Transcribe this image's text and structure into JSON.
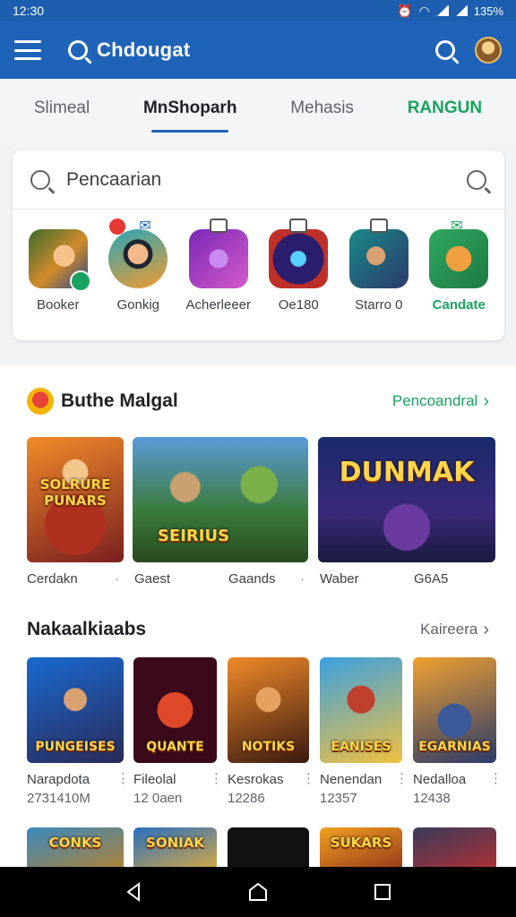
{
  "status": {
    "time": "12:30",
    "battery": "135%"
  },
  "app_bar": {
    "title": "Chdougat",
    "icons": [
      "menu-icon",
      "search-icon",
      "search-icon",
      "avatar"
    ]
  },
  "tabs": [
    {
      "label": "Slimeal",
      "active": false
    },
    {
      "label": "MnShoparh",
      "active": true
    },
    {
      "label": "Mehasis",
      "active": false
    },
    {
      "label": "RANGUN",
      "active": false,
      "accent": "#1aa260"
    }
  ],
  "search": {
    "text": "Pencaarian"
  },
  "categories": [
    {
      "label": "Booker",
      "badge": "none"
    },
    {
      "label": "Gonkig",
      "badge": "mail"
    },
    {
      "label": "Acherleeer",
      "badge": "box"
    },
    {
      "label": "Oe180",
      "badge": "box"
    },
    {
      "label": "Starro 0",
      "badge": "box"
    },
    {
      "label": "Candate",
      "badge": "mail",
      "accent": "#1aa260"
    }
  ],
  "featured": {
    "title": "Buthe Malgal",
    "link": "Pencoandral",
    "cards": [
      {
        "label": "Cerdakn",
        "art": "SOLRURE PUNARS"
      },
      {
        "label": "Gaest",
        "art": "SEIRIUS"
      },
      {
        "label": "Gaands",
        "art": ""
      },
      {
        "label": "Waber",
        "art": "DUNMAK"
      },
      {
        "label": "G6A5",
        "art": ""
      }
    ]
  },
  "popular": {
    "title": "Nakaalkiaabs",
    "link": "Kaireera",
    "items": [
      {
        "name": "Narapdota",
        "sub": "2731410M",
        "art": "PUNGEISES"
      },
      {
        "name": "Fileolal",
        "sub": "12 0aen",
        "art": "QUANTE"
      },
      {
        "name": "Kesrokas",
        "sub": "12286",
        "art": "NOTIKS"
      },
      {
        "name": "Nenendan",
        "sub": "12357",
        "art": "EANISES"
      },
      {
        "name": "Nedalloa",
        "sub": "12438",
        "art": "EGARNIAS"
      }
    ],
    "row2_art": [
      "CONKS",
      "SONIAK",
      "",
      "SUKARS",
      ""
    ]
  },
  "colors": {
    "primary": "#1f63b9",
    "accent": "#1aa260"
  }
}
